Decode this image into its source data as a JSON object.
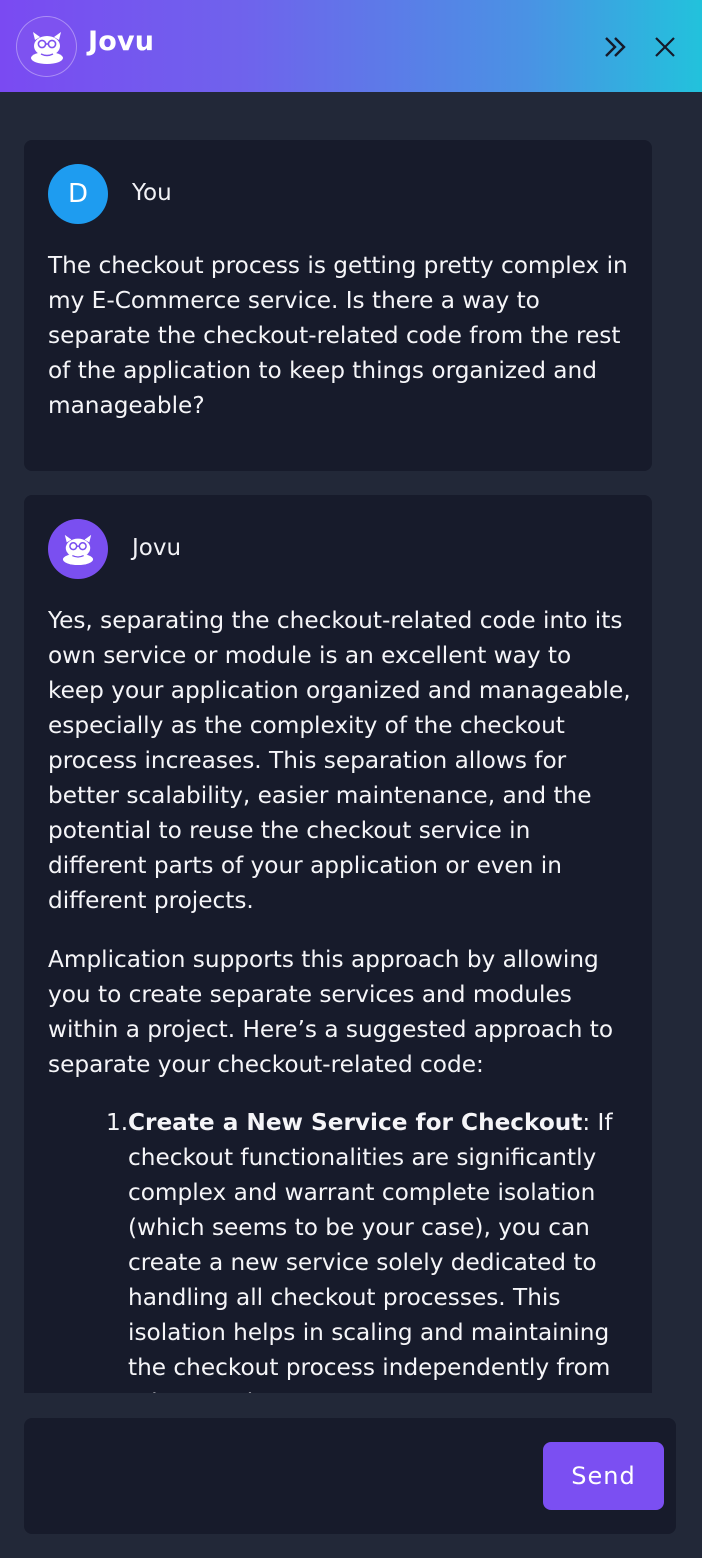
{
  "header": {
    "title": "Jovu",
    "logo_icon": "jovu-mascot-icon",
    "expand_icon": "chevrons-right-icon",
    "close_icon": "close-icon"
  },
  "messages": [
    {
      "author": "You",
      "avatar_letter": "D",
      "avatar_color": "#1e9cf0",
      "text": "The checkout process is getting pretty complex in my E-Commerce service. Is there a way to separate the checkout-related code from the rest of the application to keep things organized and manageable?"
    },
    {
      "author": "Jovu",
      "avatar_icon": "jovu-mascot-icon",
      "avatar_color": "#7a4ff0",
      "paragraphs": [
        "Yes, separating the checkout-related code into its own service or module is an excellent way to keep your application organized and manageable, especially as the complexity of the checkout process increases. This separation allows for better scalability, easier maintenance, and the potential to reuse the checkout service in different parts of your application or even in different projects.",
        "Amplication supports this approach by allowing you to create separate services and modules within a project. Here’s a suggested approach to separate your checkout-related code:"
      ],
      "list": [
        {
          "number": "1.",
          "title": "Create a New Service for Checkout",
          "text": ": If checkout functionalities are significantly complex and warrant complete isolation (which seems to be your case), you can create a new service solely dedicated to handling all checkout processes. This isolation helps in scaling and maintaining the checkout process independently from other services."
        }
      ]
    }
  ],
  "composer": {
    "placeholder": "",
    "send_label": "Send"
  },
  "colors": {
    "accent": "#7b4ff2",
    "background": "#222838",
    "card": "#171b2b",
    "header_gradient_start": "#7a4af2",
    "header_gradient_end": "#22c2dc"
  }
}
